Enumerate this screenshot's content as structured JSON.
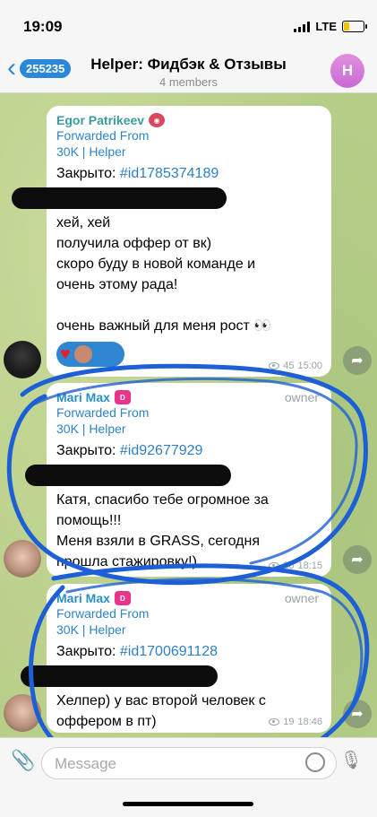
{
  "status_bar": {
    "time": "19:09",
    "network": "LTE"
  },
  "header": {
    "back_count": "255235",
    "title": "Helper: Фидбэк & Отзывы",
    "subtitle": "4 members",
    "avatar_letter": "H"
  },
  "messages": [
    {
      "sender": "Egor Patrikeev",
      "forwarded_label": "Forwarded From",
      "forwarded_source": "30K | Helper",
      "closed_prefix": "Закрыто: ",
      "ticket": "#id1785374189",
      "lines": [
        "хей, хей",
        "получила оффер от вк)",
        "скоро буду в новой команде и",
        "очень этому рада!",
        "",
        "очень важный для меня рост 👀"
      ],
      "views": "45",
      "time": "15:00"
    },
    {
      "sender": "Mari Max",
      "role": "owner",
      "forwarded_label": "Forwarded From",
      "forwarded_source": "30K | Helper",
      "closed_prefix": "Закрыто: ",
      "ticket": "#id92677929",
      "lines": [
        "Катя, спасибо тебе огромное за",
        "помощь!!!",
        "Меня взяли в GRASS, сегодня",
        "прошла стажировку!)"
      ],
      "views": "36",
      "time": "18:15"
    },
    {
      "sender": "Mari Max",
      "role": "owner",
      "forwarded_label": "Forwarded From",
      "forwarded_source": "30K | Helper",
      "closed_prefix": "Закрыто: ",
      "ticket": "#id1700691128",
      "lines": [
        "Хелпер) у вас второй человек с",
        "оффером в пт)"
      ],
      "views": "19",
      "time": "18:46"
    }
  ],
  "composer": {
    "placeholder": "Message"
  },
  "icons": {
    "back": "chevron-left-icon",
    "attach": "paperclip-icon",
    "sticker": "sticker-icon",
    "mic": "microphone-icon",
    "share": "share-arrow-icon",
    "views": "eye-icon"
  },
  "colors": {
    "accent": "#2b87d8",
    "scribble": "#1d5fd6",
    "bubble": "#ffffff"
  }
}
